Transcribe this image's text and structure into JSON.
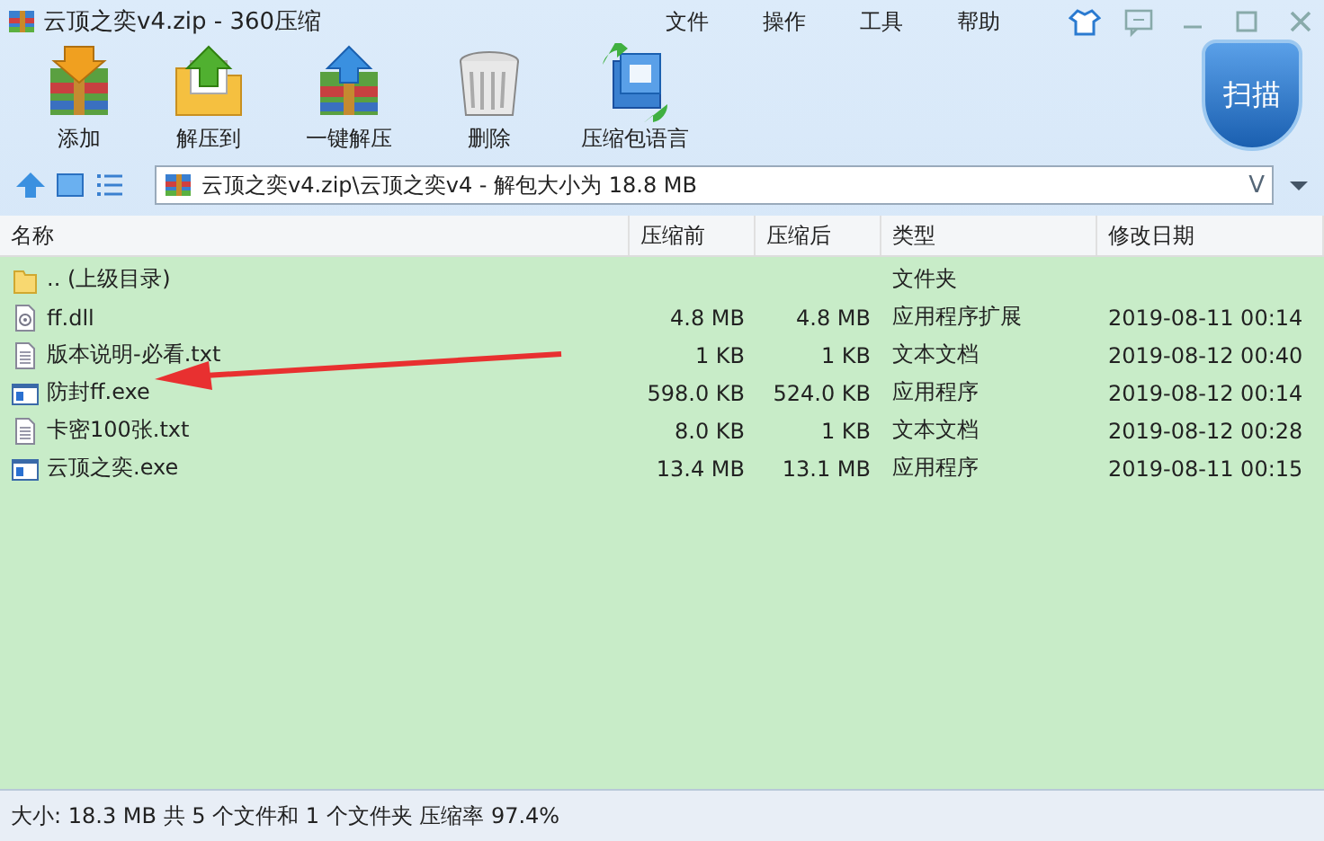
{
  "window": {
    "title": "云顶之奕v4.zip - 360压缩"
  },
  "menu": [
    "文件",
    "操作",
    "工具",
    "帮助"
  ],
  "toolbar": [
    {
      "label": "添加",
      "kind": "add"
    },
    {
      "label": "解压到",
      "kind": "extract"
    },
    {
      "label": "一键解压",
      "kind": "quick"
    },
    {
      "label": "删除",
      "kind": "delete"
    },
    {
      "label": "压缩包语言",
      "kind": "lang"
    }
  ],
  "scan_button": {
    "label": "扫描"
  },
  "address": {
    "value": "云顶之奕v4.zip\\云顶之奕v4 - 解包大小为 18.8 MB",
    "hint": "V"
  },
  "table": {
    "columns": [
      "名称",
      "压缩前",
      "压缩后",
      "类型",
      "修改日期"
    ],
    "rows": [
      {
        "kind": "folder",
        "name": ".. (上级目录)",
        "before": "",
        "after": "",
        "type": "文件夹",
        "date": ""
      },
      {
        "kind": "dll",
        "name": "ff.dll",
        "before": "4.8 MB",
        "after": "4.8 MB",
        "type": "应用程序扩展",
        "date": "2019-08-11 00:14"
      },
      {
        "kind": "txt",
        "name": "版本说明-必看.txt",
        "before": "1 KB",
        "after": "1 KB",
        "type": "文本文档",
        "date": "2019-08-12 00:40"
      },
      {
        "kind": "exe",
        "name": "防封ff.exe",
        "before": "598.0 KB",
        "after": "524.0 KB",
        "type": "应用程序",
        "date": "2019-08-12 00:14"
      },
      {
        "kind": "txt",
        "name": "卡密100张.txt",
        "before": "8.0 KB",
        "after": "1 KB",
        "type": "文本文档",
        "date": "2019-08-12 00:28"
      },
      {
        "kind": "exe",
        "name": "云顶之奕.exe",
        "before": "13.4 MB",
        "after": "13.1 MB",
        "type": "应用程序",
        "date": "2019-08-11 00:15"
      }
    ]
  },
  "status_bar": "大小: 18.3 MB 共 5 个文件和 1 个文件夹 压缩率 97.4%"
}
